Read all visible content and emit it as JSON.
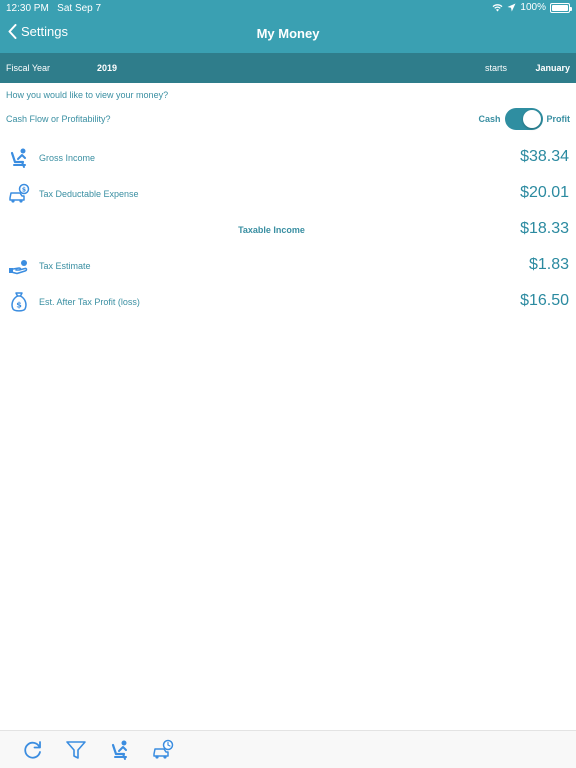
{
  "status_bar": {
    "time": "12:30 PM",
    "date": "Sat Sep 7",
    "battery": "100%"
  },
  "nav": {
    "back_label": "Settings",
    "title": "My Money"
  },
  "fiscal": {
    "label": "Fiscal Year",
    "year": "2019",
    "starts_label": "starts",
    "month": "January"
  },
  "prompt": "How you would like to view your money?",
  "mode": {
    "question": "Cash Flow or Profitability?",
    "left_label": "Cash",
    "right_label": "Profit",
    "state": "Profit"
  },
  "rows": [
    {
      "icon": "driver-seat-icon",
      "label": "Gross Income",
      "value": "$38.34"
    },
    {
      "icon": "car-money-icon",
      "label": "Tax Deductable Expense",
      "value": "$20.01"
    },
    {
      "label": "Taxable Income",
      "value": "$18.33"
    },
    {
      "icon": "hand-coin-icon",
      "label": "Tax Estimate",
      "value": "$1.83"
    },
    {
      "icon": "money-bag-icon",
      "label": "Est. After Tax Profit (loss)",
      "value": "$16.50"
    }
  ],
  "toolbar": [
    "refresh-icon",
    "filter-icon",
    "driver-seat-icon",
    "car-clock-icon"
  ],
  "colors": {
    "header": "#3aa0b2",
    "fiscal_bar": "#2f7d8b",
    "accent": "#2b8aa0",
    "icon": "#3b8de0"
  }
}
